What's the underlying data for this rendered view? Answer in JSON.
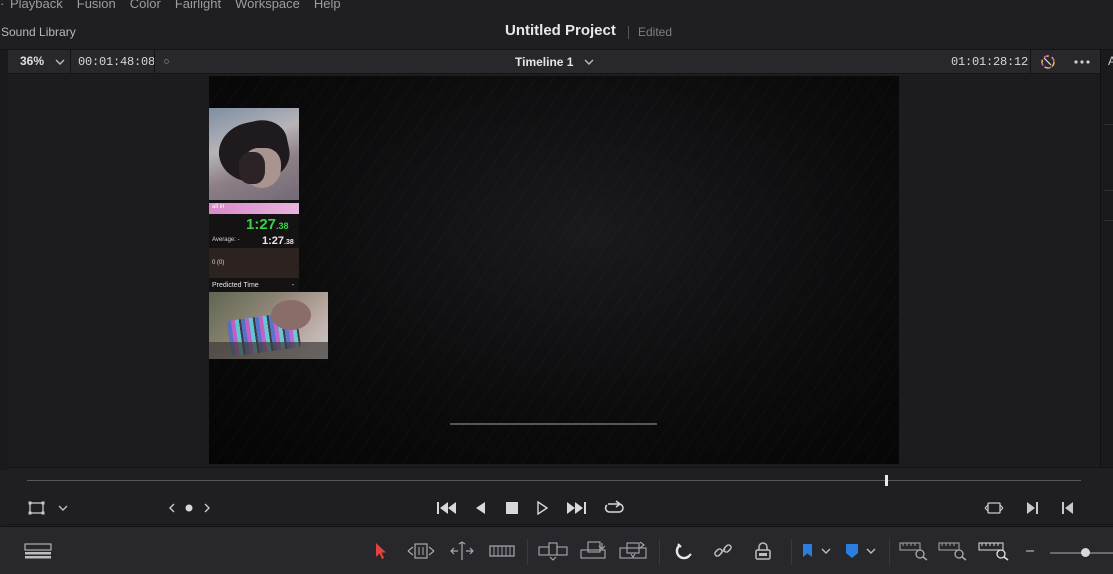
{
  "menu": {
    "items": [
      "Playback",
      "Fusion",
      "Color",
      "Fairlight",
      "Workspace",
      "Help"
    ]
  },
  "titlebar": {
    "sound_library": "Sound Library",
    "project_title": "Untitled Project",
    "status": "Edited"
  },
  "viewer": {
    "zoom": "36%",
    "source_timecode": "00:01:48:08",
    "timeline_name": "Timeline 1",
    "record_timecode": "01:01:28:12",
    "right_strip_label": "A"
  },
  "overlay": {
    "splits_bar_label": "all in",
    "splits_bar_extra": "-",
    "main_time": "1:27",
    "main_time_ms": ".38",
    "average_label": "Average",
    "average_dash": "-",
    "average_time": "1:27",
    "average_time_ms": ".38",
    "count": "0 (0)",
    "predicted_label": "Predicted Time",
    "predicted_value": "-"
  },
  "scrubber": {
    "playhead_fraction": 0.815
  },
  "icons": {
    "viewer_mode": "transform-rect-icon",
    "nav": "clip-navigation-icon",
    "first": "skip-to-start-icon",
    "reverse": "play-reverse-icon",
    "stop": "stop-icon",
    "play": "play-icon",
    "last": "skip-to-end-icon",
    "loop": "loop-icon",
    "match": "match-frame-icon",
    "in_point": "mark-in-icon",
    "out_point": "mark-out-icon"
  },
  "colors": {
    "accent_red": "#e0443c",
    "flag_blue": "#2a7de1",
    "timer_green": "#37d447"
  }
}
